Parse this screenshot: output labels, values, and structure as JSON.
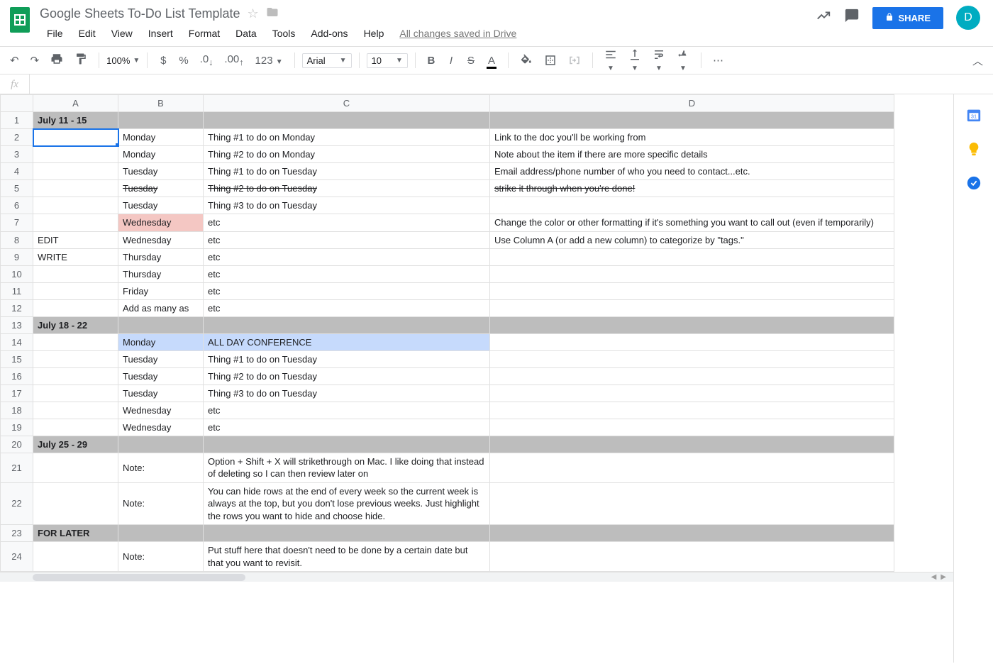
{
  "doc_title": "Google Sheets To-Do List Template",
  "status": "All changes saved in Drive",
  "menu": [
    "File",
    "Edit",
    "View",
    "Insert",
    "Format",
    "Data",
    "Tools",
    "Add-ons",
    "Help"
  ],
  "share_label": "SHARE",
  "avatar_letter": "D",
  "toolbar": {
    "zoom": "100%",
    "font": "Arial",
    "size": "10",
    "num_fmt": "123"
  },
  "columns": [
    "A",
    "B",
    "C",
    "D"
  ],
  "active_cell": {
    "row": 2,
    "col": "A"
  },
  "rows": [
    {
      "n": 1,
      "header": true,
      "cells": {
        "A": "July 11 - 15",
        "B": "",
        "C": "",
        "D": ""
      }
    },
    {
      "n": 2,
      "cells": {
        "A": "",
        "B": "Monday",
        "C": "Thing #1 to do on Monday",
        "D": "Link to the doc you'll be working from"
      }
    },
    {
      "n": 3,
      "cells": {
        "A": "",
        "B": "Monday",
        "C": "Thing #2 to do on Monday",
        "D": "Note about the item if there are more specific details"
      }
    },
    {
      "n": 4,
      "cells": {
        "A": "",
        "B": "Tuesday",
        "C": "Thing #1 to do on Tuesday",
        "D": "Email address/phone number of who you need to contact...etc."
      }
    },
    {
      "n": 5,
      "strike": [
        "B",
        "C",
        "D"
      ],
      "cells": {
        "A": "",
        "B": "Tuesday",
        "C": "Thing #2 to do on Tuesday",
        "D": "strike it through when you're done!"
      }
    },
    {
      "n": 6,
      "cells": {
        "A": "",
        "B": "Tuesday",
        "C": "Thing #3 to do on Tuesday",
        "D": ""
      }
    },
    {
      "n": 7,
      "hl": {
        "B": "red"
      },
      "wrap": [
        "D"
      ],
      "cells": {
        "A": "",
        "B": "Wednesday",
        "C": "etc",
        "D": "Change the color or other formatting if it's something you want to call out (even if temporarily)"
      }
    },
    {
      "n": 8,
      "cells": {
        "A": "EDIT",
        "B": "Wednesday",
        "C": "etc",
        "D": "Use Column A (or add a new column) to categorize by \"tags.\""
      }
    },
    {
      "n": 9,
      "cells": {
        "A": "WRITE",
        "B": "Thursday",
        "C": "etc",
        "D": ""
      }
    },
    {
      "n": 10,
      "cells": {
        "A": "",
        "B": "Thursday",
        "C": "etc",
        "D": ""
      }
    },
    {
      "n": 11,
      "cells": {
        "A": "",
        "B": "Friday",
        "C": "etc",
        "D": ""
      }
    },
    {
      "n": 12,
      "cells": {
        "A": "",
        "B": "Add as many as",
        "C": "etc",
        "D": ""
      }
    },
    {
      "n": 13,
      "header": true,
      "cells": {
        "A": "July 18 - 22",
        "B": "",
        "C": "",
        "D": ""
      }
    },
    {
      "n": 14,
      "hl": {
        "B": "blue",
        "C": "blue"
      },
      "cells": {
        "A": "",
        "B": "Monday",
        "C": "ALL DAY CONFERENCE",
        "D": ""
      }
    },
    {
      "n": 15,
      "cells": {
        "A": "",
        "B": "Tuesday",
        "C": "Thing #1 to do on Tuesday",
        "D": ""
      }
    },
    {
      "n": 16,
      "cells": {
        "A": "",
        "B": "Tuesday",
        "C": "Thing #2 to do on Tuesday",
        "D": ""
      }
    },
    {
      "n": 17,
      "cells": {
        "A": "",
        "B": "Tuesday",
        "C": "Thing #3 to do on Tuesday",
        "D": ""
      }
    },
    {
      "n": 18,
      "cells": {
        "A": "",
        "B": "Wednesday",
        "C": "etc",
        "D": ""
      }
    },
    {
      "n": 19,
      "cells": {
        "A": "",
        "B": "Wednesday",
        "C": "etc",
        "D": ""
      }
    },
    {
      "n": 20,
      "header": true,
      "cells": {
        "A": "July 25 - 29",
        "B": "",
        "C": "",
        "D": ""
      }
    },
    {
      "n": 21,
      "wrap": [
        "C"
      ],
      "cells": {
        "A": "",
        "B": "Note:",
        "C": "Option + Shift + X will strikethrough on Mac. I like doing that instead of deleting so I can then review later on",
        "D": ""
      }
    },
    {
      "n": 22,
      "wrap": [
        "C"
      ],
      "cells": {
        "A": "",
        "B": "Note:",
        "C": "You can hide rows at the end of every week so the current week is always at the top, but you don't lose previous weeks. Just highlight the rows you want to hide and choose hide.",
        "D": ""
      }
    },
    {
      "n": 23,
      "header": true,
      "cells": {
        "A": "FOR LATER",
        "B": "",
        "C": "",
        "D": ""
      }
    },
    {
      "n": 24,
      "wrap": [
        "C"
      ],
      "cells": {
        "A": "",
        "B": "Note:",
        "C": "Put stuff here that doesn't need to be done by a certain date but that you want to revisit.",
        "D": ""
      }
    }
  ]
}
